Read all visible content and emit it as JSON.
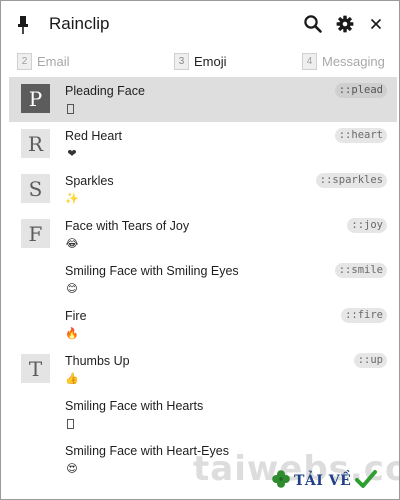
{
  "window": {
    "title": "Rainclip",
    "buttons": {
      "search": "search-icon",
      "settings": "gear-icon",
      "close": "close-icon"
    }
  },
  "tabs": [
    {
      "number": "2",
      "label": "Email",
      "active": false
    },
    {
      "number": "3",
      "label": "Emoji",
      "active": true
    },
    {
      "number": "4",
      "label": "Messaging",
      "active": false
    }
  ],
  "items": [
    {
      "letter": "P",
      "name": "Pleading Face",
      "glyph": "",
      "code": "::plead",
      "selected": true
    },
    {
      "letter": "R",
      "name": "Red Heart",
      "glyph": "❤",
      "code": "::heart",
      "selected": false
    },
    {
      "letter": "S",
      "name": "Sparkles",
      "glyph": "✨",
      "code": "::sparkles",
      "selected": false
    },
    {
      "letter": "F",
      "name": "Face with Tears of Joy",
      "glyph": "😂",
      "code": "::joy",
      "selected": false
    },
    {
      "letter": "",
      "name": "Smiling Face with Smiling Eyes",
      "glyph": "😊",
      "code": "::smile",
      "selected": false
    },
    {
      "letter": "",
      "name": "Fire",
      "glyph": "🔥",
      "code": "::fire",
      "selected": false
    },
    {
      "letter": "T",
      "name": "Thumbs Up",
      "glyph": "👍",
      "code": "::up",
      "selected": false
    },
    {
      "letter": "",
      "name": "Smiling Face with Hearts",
      "glyph": "",
      "code": "",
      "selected": false
    },
    {
      "letter": "",
      "name": "Smiling Face with Heart-Eyes",
      "glyph": "😍",
      "code": "",
      "selected": false
    }
  ],
  "watermark": {
    "text": "taiwebs.com",
    "badge": "TẢI VỀ"
  },
  "colors": {
    "selected_row": "#dedede",
    "selected_letter_bg": "#5c5c5c",
    "letter_bg": "#e4e4e4",
    "code_pill": "#e6e6e6",
    "badge_text": "#1f3f86",
    "badge_check": "#2e9e2e",
    "badge_clover": "#2e8b2e"
  }
}
